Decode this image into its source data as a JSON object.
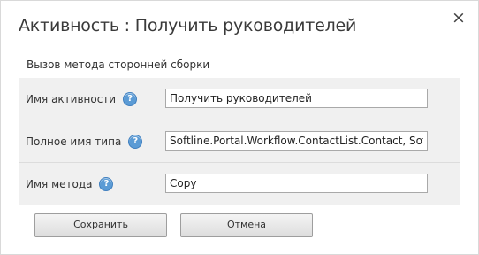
{
  "dialog": {
    "title": "Активность : Получить руководителей",
    "close_glyph": "×"
  },
  "section": {
    "label": "Вызов метода сторонней сборки"
  },
  "fields": [
    {
      "label": "Имя активности",
      "value": "Получить руководителей",
      "help_glyph": "?"
    },
    {
      "label": "Полное имя типа",
      "value": "Softline.Portal.Workflow.ContactList.Contact, Softline.Portal.Workflow",
      "help_glyph": "?"
    },
    {
      "label": "Имя метода",
      "value": "Copy",
      "help_glyph": "?"
    }
  ],
  "buttons": {
    "save_label": "Сохранить",
    "cancel_label": "Отмена"
  },
  "colors": {
    "help_icon": "#5b9bd5",
    "row_background": "#f0f0f0"
  }
}
